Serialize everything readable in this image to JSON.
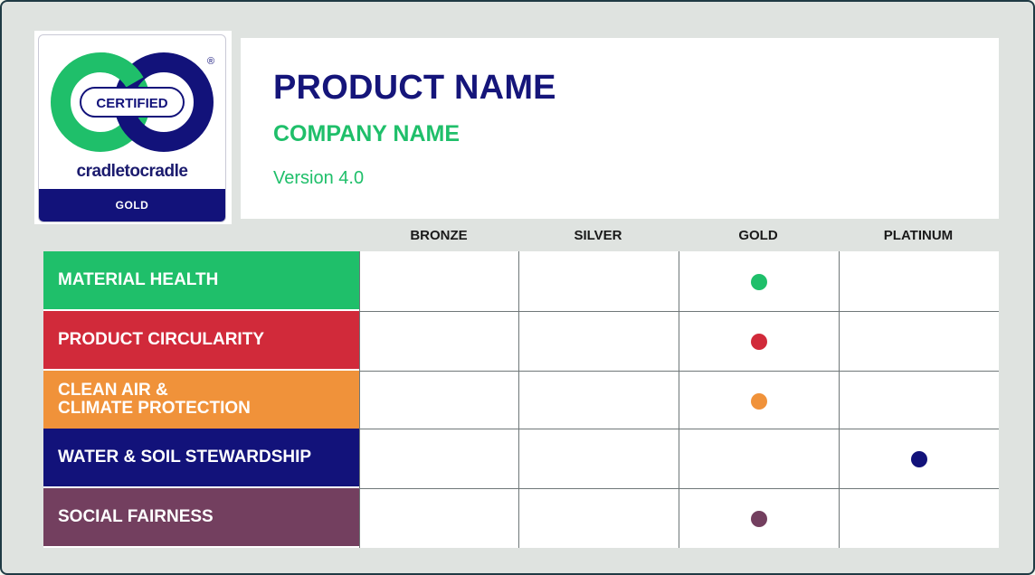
{
  "logo": {
    "certified_text": "CERTIFIED",
    "wordmark": "cradletocradle",
    "registered_mark": "®",
    "level_band": "GOLD",
    "colors": {
      "green": "#1fbf6a",
      "navy": "#12127a"
    }
  },
  "header": {
    "product_name": "PRODUCT NAME",
    "company_name": "COMPANY NAME",
    "version": "Version 4.0"
  },
  "levels": [
    "BRONZE",
    "SILVER",
    "GOLD",
    "PLATINUM"
  ],
  "categories": [
    {
      "label": "MATERIAL HEALTH",
      "color": "#1fbf6a",
      "achieved_level": "GOLD"
    },
    {
      "label": "PRODUCT CIRCULARITY",
      "color": "#d12a3a",
      "achieved_level": "GOLD"
    },
    {
      "label": "CLEAN AIR &\nCLIMATE PROTECTION",
      "color": "#f0923a",
      "achieved_level": "GOLD"
    },
    {
      "label": "WATER & SOIL STEWARDSHIP",
      "color": "#12127a",
      "achieved_level": "PLATINUM"
    },
    {
      "label": "SOCIAL FAIRNESS",
      "color": "#733f5f",
      "achieved_level": "GOLD"
    }
  ]
}
